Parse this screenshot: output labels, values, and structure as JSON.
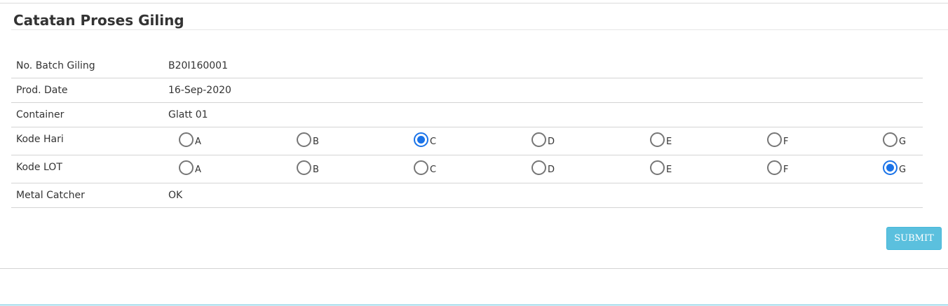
{
  "panel": {
    "title": "Catatan Proses Giling"
  },
  "form": {
    "batch": {
      "label": "No. Batch Giling",
      "value": "B20I160001"
    },
    "prod_date": {
      "label": "Prod. Date",
      "value": "16-Sep-2020"
    },
    "container": {
      "label": "Container",
      "value": "Glatt 01"
    },
    "kode_hari": {
      "label": "Kode Hari",
      "options": [
        "A",
        "B",
        "C",
        "D",
        "E",
        "F",
        "G"
      ],
      "selected": "C"
    },
    "kode_lot": {
      "label": "Kode LOT",
      "options": [
        "A",
        "B",
        "C",
        "D",
        "E",
        "F",
        "G"
      ],
      "selected": "G"
    },
    "metal_catcher": {
      "label": "Metal Catcher",
      "value": "OK"
    }
  },
  "actions": {
    "submit_label": "SUBMIT"
  },
  "colors": {
    "accent": "#1a73e8",
    "submit_bg": "#5bc0de"
  }
}
